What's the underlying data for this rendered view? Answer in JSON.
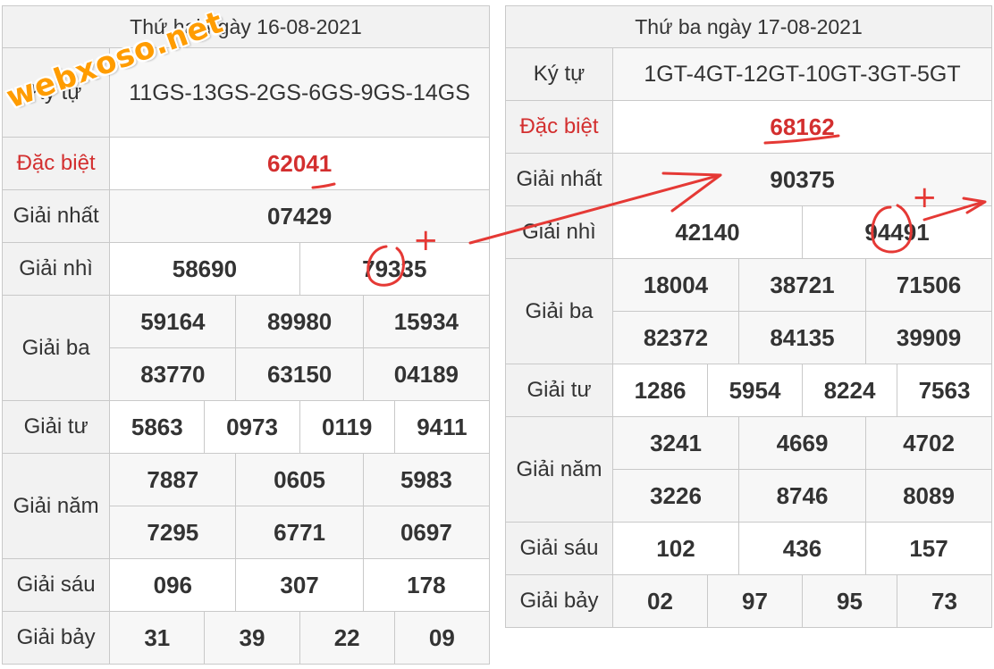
{
  "watermark": "webxoso.net",
  "left": {
    "date": "Thứ hai ngày 16-08-2021",
    "labels": {
      "kytu": "Ký tự",
      "db": "Đặc biệt",
      "g1": "Giải nhất",
      "g2": "Giải nhì",
      "g3": "Giải ba",
      "g4": "Giải tư",
      "g5": "Giải năm",
      "g6": "Giải sáu",
      "g7": "Giải bảy"
    },
    "kytu": "11GS-13GS-2GS-6GS-9GS-14GS",
    "db": "62041",
    "g1": "07429",
    "g2": [
      "58690",
      "79335"
    ],
    "g3": [
      "59164",
      "89980",
      "15934",
      "83770",
      "63150",
      "04189"
    ],
    "g4": [
      "5863",
      "0973",
      "0119",
      "9411"
    ],
    "g5": [
      "7887",
      "0605",
      "5983",
      "7295",
      "6771",
      "0697"
    ],
    "g6": [
      "096",
      "307",
      "178"
    ],
    "g7": [
      "31",
      "39",
      "22",
      "09"
    ]
  },
  "right": {
    "date": "Thứ ba ngày 17-08-2021",
    "labels": {
      "kytu": "Ký tự",
      "db": "Đặc biệt",
      "g1": "Giải nhất",
      "g2": "Giải nhì",
      "g3": "Giải ba",
      "g4": "Giải tư",
      "g5": "Giải năm",
      "g6": "Giải sáu",
      "g7": "Giải bảy"
    },
    "kytu": "1GT-4GT-12GT-10GT-3GT-5GT",
    "db": "68162",
    "g1": "90375",
    "g2": [
      "42140",
      "94491"
    ],
    "g3": [
      "18004",
      "38721",
      "71506",
      "82372",
      "84135",
      "39909"
    ],
    "g4": [
      "1286",
      "5954",
      "8224",
      "7563"
    ],
    "g5": [
      "3241",
      "4669",
      "4702",
      "3226",
      "8746",
      "8089"
    ],
    "g6": [
      "102",
      "436",
      "157"
    ],
    "g7": [
      "02",
      "97",
      "95",
      "73"
    ]
  },
  "annotations": {
    "plus_sign": "+",
    "ink_color": "#e53935"
  }
}
